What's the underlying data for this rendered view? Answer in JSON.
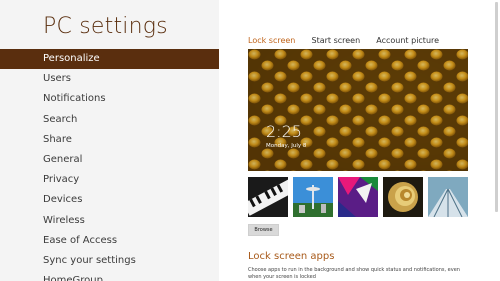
{
  "app": {
    "title": "PC settings"
  },
  "nav": {
    "items": [
      {
        "label": "Personalize",
        "selected": true
      },
      {
        "label": "Users"
      },
      {
        "label": "Notifications"
      },
      {
        "label": "Search"
      },
      {
        "label": "Share"
      },
      {
        "label": "General"
      },
      {
        "label": "Privacy"
      },
      {
        "label": "Devices"
      },
      {
        "label": "Wireless"
      },
      {
        "label": "Ease of Access"
      },
      {
        "label": "Sync your settings"
      },
      {
        "label": "HomeGroup"
      }
    ]
  },
  "tabs": [
    {
      "label": "Lock screen",
      "active": true
    },
    {
      "label": "Start screen"
    },
    {
      "label": "Account picture"
    }
  ],
  "preview": {
    "time": "2:25",
    "date": "Monday, July 8"
  },
  "thumbnails": [
    {
      "icon": "piano-keys-thumbnail"
    },
    {
      "icon": "space-needle-thumbnail"
    },
    {
      "icon": "abstract-colors-thumbnail"
    },
    {
      "icon": "nautilus-shell-thumbnail"
    },
    {
      "icon": "escalator-thumbnail"
    }
  ],
  "browse": {
    "label": "Browse"
  },
  "lock_screen_apps": {
    "title": "Lock screen apps",
    "description": "Choose apps to run in the background and show quick status and notifications, even when your screen is locked"
  },
  "colors": {
    "accent": "#5a2e0e",
    "tab_active": "#c0641a",
    "section_title": "#a85a1a"
  }
}
